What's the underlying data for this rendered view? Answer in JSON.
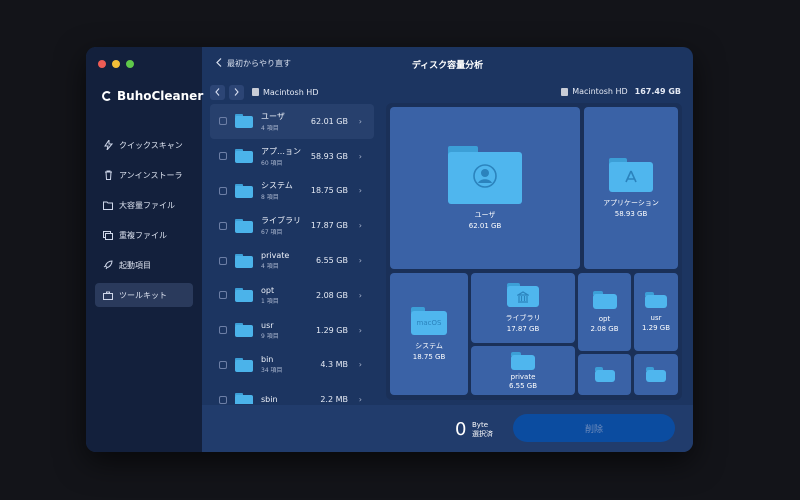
{
  "app": {
    "brand": "BuhoCleaner",
    "back_label": "最初からやり直す",
    "title": "ディスク容量分析"
  },
  "sidebar": {
    "items": [
      {
        "label": "クイックスキャン",
        "icon": "bolt-icon"
      },
      {
        "label": "アンインストーラ",
        "icon": "trash-icon"
      },
      {
        "label": "大容量ファイル",
        "icon": "folder-icon"
      },
      {
        "label": "重複ファイル",
        "icon": "duplicate-icon"
      },
      {
        "label": "起動項目",
        "icon": "rocket-icon"
      },
      {
        "label": "ツールキット",
        "icon": "toolkit-icon",
        "active": true
      }
    ]
  },
  "path": {
    "current": "Macintosh HD",
    "disk_name": "Macintosh HD",
    "disk_total": "167.49 GB"
  },
  "list": {
    "rows": [
      {
        "name": "ユーザ",
        "count": "4 項目",
        "size": "62.01 GB",
        "selected": true
      },
      {
        "name": "アプ…ョン",
        "count": "60 項目",
        "size": "58.93 GB"
      },
      {
        "name": "システム",
        "count": "8 項目",
        "size": "18.75 GB"
      },
      {
        "name": "ライブラリ",
        "count": "67 項目",
        "size": "17.87 GB"
      },
      {
        "name": "private",
        "count": "4 項目",
        "size": "6.55 GB"
      },
      {
        "name": "opt",
        "count": "1 項目",
        "size": "2.08 GB"
      },
      {
        "name": "usr",
        "count": "9 項目",
        "size": "1.29 GB"
      },
      {
        "name": "bin",
        "count": "34 項目",
        "size": "4.3 MB"
      },
      {
        "name": "sbin",
        "count": "",
        "size": "2.2 MB"
      }
    ]
  },
  "treemap": {
    "tiles": [
      {
        "key": "users",
        "name": "ユーザ",
        "size": "62.01 GB",
        "glyph": "user-icon"
      },
      {
        "key": "applications",
        "name": "アプリケーション",
        "size": "58.93 GB",
        "glyph": "app-store-icon"
      },
      {
        "key": "system",
        "name": "システム",
        "size": "18.75 GB",
        "glyph": "macos-text",
        "badge": "macOS"
      },
      {
        "key": "library",
        "name": "ライブラリ",
        "size": "17.87 GB",
        "glyph": "library-icon"
      },
      {
        "key": "private",
        "name": "private",
        "size": "6.55 GB"
      },
      {
        "key": "opt",
        "name": "opt",
        "size": "2.08 GB"
      },
      {
        "key": "usr",
        "name": "usr",
        "size": "1.29 GB"
      },
      {
        "key": "small1",
        "name": "",
        "size": ""
      },
      {
        "key": "small2",
        "name": "",
        "size": ""
      }
    ]
  },
  "footer": {
    "selected_count": "0",
    "unit": "Byte",
    "unit_sub": "選択済",
    "delete_label": "削除"
  },
  "colors": {
    "accent": "#0b4ca0",
    "tile": "#3a62a6",
    "folder": "#4fb6ee",
    "sidebar": "#13203c",
    "main": "#1c3561"
  }
}
